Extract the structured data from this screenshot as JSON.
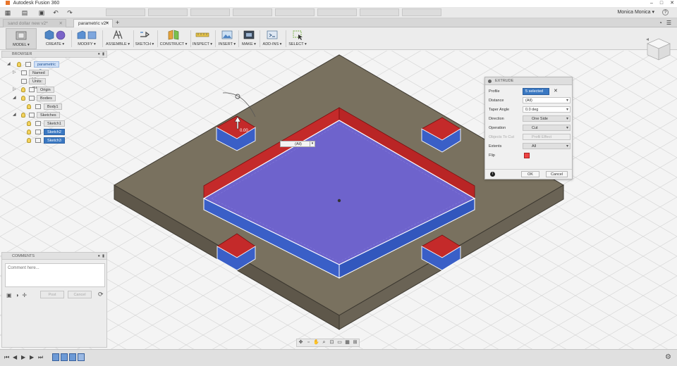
{
  "app": {
    "title": "Autodesk Fusion 360"
  },
  "quickbar": {
    "user_name": "Monica Monica ▾",
    "help": "?"
  },
  "doc_tabs": [
    {
      "label": "sand dollar new v2*"
    },
    {
      "label": "parametric v2*"
    }
  ],
  "ribbon": {
    "workspace": "MODEL ▾",
    "groups": [
      {
        "label": "CREATE ▾"
      },
      {
        "label": "MODIFY ▾"
      },
      {
        "label": "ASSEMBLE ▾"
      },
      {
        "label": "SKETCH ▾"
      },
      {
        "label": "CONSTRUCT ▾"
      },
      {
        "label": "INSPECT ▾"
      },
      {
        "label": "INSERT ▾"
      },
      {
        "label": "MAKE ▾"
      },
      {
        "label": "ADD-INS ▾"
      },
      {
        "label": "SELECT ▾"
      }
    ]
  },
  "browser": {
    "title": "BROWSER",
    "root": "parametric v2",
    "items": [
      {
        "label": "Named Views"
      },
      {
        "label": "Units: mm"
      },
      {
        "label": "Origin"
      },
      {
        "label": "Bodies"
      },
      {
        "label": "Body1"
      },
      {
        "label": "Sketches"
      },
      {
        "label": "Sketch1"
      },
      {
        "label": "Sketch2"
      },
      {
        "label": "Sketch3"
      }
    ]
  },
  "canvas": {
    "distance_value": "(All)",
    "sketch_dim": "0.00"
  },
  "extrude": {
    "title": "EXTRUDE",
    "rows": {
      "profile": {
        "label": "Profile",
        "value": "5 selected"
      },
      "distance": {
        "label": "Distance",
        "value": "(All)"
      },
      "taper": {
        "label": "Taper Angle",
        "value": "0.0 deg"
      },
      "direction": {
        "label": "Direction",
        "value": "One Side"
      },
      "operation": {
        "label": "Operation",
        "value": "Cut"
      },
      "objects": {
        "label": "Objects To Cut",
        "value": "Profil Effect"
      },
      "extents": {
        "label": "Extents",
        "value": "All"
      },
      "flip": {
        "label": "Flip"
      }
    },
    "ok": "OK",
    "cancel": "Cancel"
  },
  "comments": {
    "title": "COMMENTS",
    "placeholder": "Comment here...",
    "post": "Post",
    "cancel": "Cancel"
  },
  "colors": {
    "plate_top": "#7a7264",
    "plate_side": "#5e574c",
    "selected_face": "#6d63c9",
    "cut_wall_red": "#c62c2c",
    "cut_wall_blue": "#3b62c9",
    "accent": "#3a78c2"
  }
}
